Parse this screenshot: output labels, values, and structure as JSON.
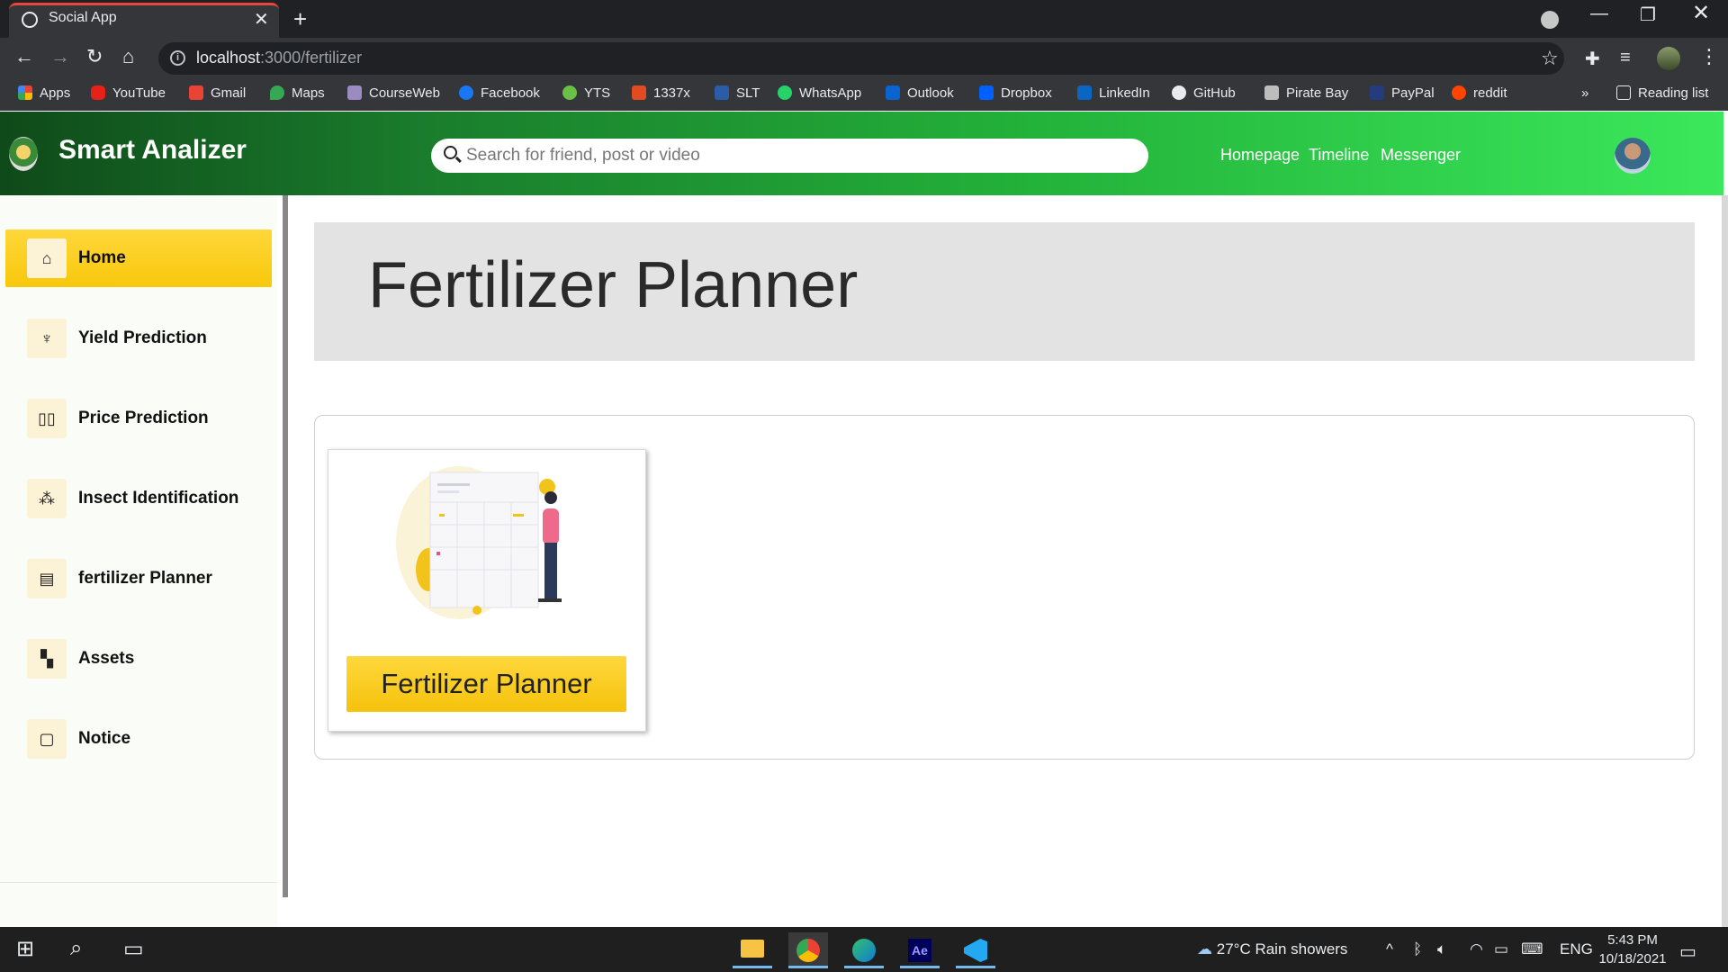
{
  "browser": {
    "tab_title": "Social App",
    "url_host": "localhost",
    "url_path": ":3000/fertilizer",
    "bookmarks": [
      "Apps",
      "YouTube",
      "Gmail",
      "Maps",
      "CourseWeb",
      "Facebook",
      "YTS",
      "1337x",
      "SLT",
      "WhatsApp",
      "Outlook",
      "Dropbox",
      "LinkedIn",
      "GitHub",
      "Pirate Bay",
      "PayPal",
      "reddit"
    ],
    "overflow": "»",
    "reading_list": "Reading list"
  },
  "header": {
    "brand": "Smart Analizer",
    "search_placeholder": "Search for friend, post or video",
    "links": [
      "Homepage",
      "Timeline",
      "Messenger"
    ]
  },
  "sidebar": {
    "items": [
      {
        "label": "Home",
        "icon": "home-icon",
        "active": true
      },
      {
        "label": "Yield Prediction",
        "icon": "plant-icon",
        "active": false
      },
      {
        "label": "Price Prediction",
        "icon": "book-icon",
        "active": false
      },
      {
        "label": "Insect Identification",
        "icon": "bug-icon",
        "active": false
      },
      {
        "label": "fertilizer Planner",
        "icon": "document-icon",
        "active": false
      },
      {
        "label": "Assets",
        "icon": "boxes-icon",
        "active": false
      },
      {
        "label": "Notice",
        "icon": "file-icon",
        "active": false
      }
    ]
  },
  "main": {
    "page_title": "Fertilizer Planner",
    "card_button": "Fertilizer Planner"
  },
  "taskbar": {
    "weather": "27°C  Rain showers",
    "lang": "ENG",
    "time": "5:43 PM",
    "date": "10/18/2021"
  },
  "colors": {
    "accent_yellow": "#f8c80c",
    "header_green": "#1a7d2c"
  }
}
